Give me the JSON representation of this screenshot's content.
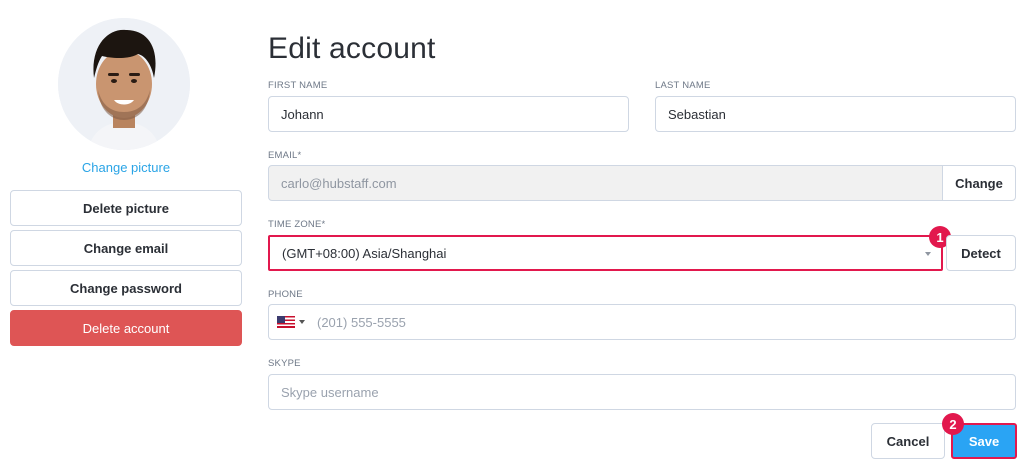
{
  "sidebar": {
    "change_picture": "Change picture",
    "buttons": [
      "Delete picture",
      "Change email",
      "Change password",
      "Delete account"
    ]
  },
  "form": {
    "title": "Edit account",
    "first_name": {
      "label": "FIRST NAME",
      "value": "Johann"
    },
    "last_name": {
      "label": "LAST NAME",
      "value": "Sebastian"
    },
    "email": {
      "label": "EMAIL*",
      "value": "carlo@hubstaff.com",
      "button": "Change"
    },
    "time_zone": {
      "label": "TIME ZONE*",
      "value": "(GMT+08:00) Asia/Shanghai",
      "button": "Detect"
    },
    "phone": {
      "label": "PHONE",
      "placeholder": "(201) 555-5555",
      "country_icon": "us-flag-icon"
    },
    "skype": {
      "label": "SKYPE",
      "placeholder": "Skype username"
    }
  },
  "actions": {
    "cancel": "Cancel",
    "save": "Save"
  },
  "annotations": {
    "badge_1": "1",
    "badge_2": "2"
  },
  "colors": {
    "accent": "#2aa4f4",
    "danger": "#de5555",
    "highlight": "#e2184d"
  }
}
